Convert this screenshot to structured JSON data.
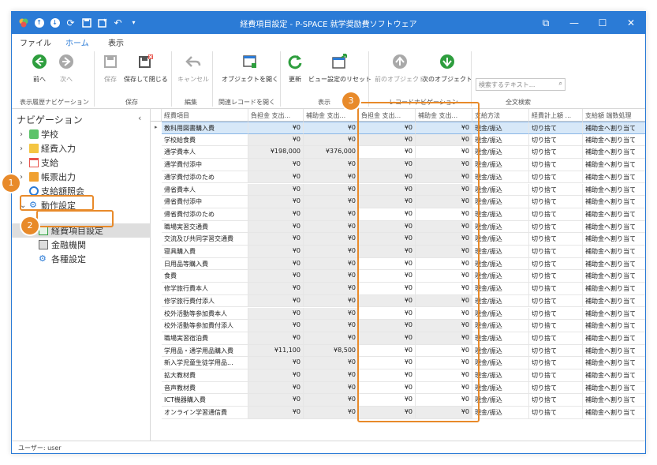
{
  "window": {
    "title": "経費項目設定 - P-SPACE 就学奨励費ソフトウェア",
    "controls": [
      "⧉",
      "—",
      "☐",
      "✕"
    ]
  },
  "menu": {
    "tabs": [
      "ファイル",
      "ホーム",
      "表示"
    ],
    "active": "ホーム"
  },
  "ribbon": {
    "buttons": {
      "forward_back": {
        "back": "前へ",
        "next": "次へ"
      },
      "save": "保存",
      "save_close": "保存して閉じる",
      "cancel": "キャンセル",
      "open_object": "オブジェクトを開く",
      "refresh": "更新",
      "view_reset": "ビュー設定のリセット",
      "prev_object": "前のオブジェクト",
      "next_object": "次のオブジェクト"
    },
    "groups": {
      "history": "表示履歴ナビゲーション",
      "save": "保存",
      "edit": "編集",
      "related": "関連レコードを開く",
      "view": "表示",
      "record_nav": "レコードナビゲーション",
      "fulltext": "全文検索"
    },
    "search_placeholder": "検索するテキスト..."
  },
  "nav": {
    "title": "ナビゲーション",
    "items": [
      "学校",
      "経費入力",
      "支給",
      "帳票出力",
      "支給額照会",
      "動作設定"
    ],
    "subitems": [
      "経費項目設定",
      "金融機関",
      "各種設定"
    ]
  },
  "grid": {
    "columns": [
      "経費項目",
      "負担金 支出...",
      "補助金 支出...",
      "負担金 支出...",
      "補助金 支出...",
      "支給方法",
      "経費計上額 ...",
      "支給額 端数処理"
    ],
    "rows": [
      [
        "教科用図書購入費",
        "¥0",
        "¥0",
        "¥0",
        "¥0",
        "現金/振込",
        "切り捨て",
        "補助金へ割り当て"
      ],
      [
        "学校給食費",
        "¥0",
        "¥0",
        "¥0",
        "¥0",
        "現金/振込",
        "切り捨て",
        "補助金へ割り当て"
      ],
      [
        "通学費本人",
        "¥198,000",
        "¥376,000",
        "¥0",
        "¥0",
        "現金/振込",
        "切り捨て",
        "補助金へ割り当て"
      ],
      [
        "通学費付添中",
        "¥0",
        "¥0",
        "¥0",
        "¥0",
        "現金/振込",
        "切り捨て",
        "補助金へ割り当て"
      ],
      [
        "通学費付添のため",
        "¥0",
        "¥0",
        "¥0",
        "¥0",
        "現金/振込",
        "切り捨て",
        "補助金へ割り当て"
      ],
      [
        "帰省費本人",
        "¥0",
        "¥0",
        "¥0",
        "¥0",
        "現金/振込",
        "切り捨て",
        "補助金へ割り当て"
      ],
      [
        "帰省費付添中",
        "¥0",
        "¥0",
        "¥0",
        "¥0",
        "現金/振込",
        "切り捨て",
        "補助金へ割り当て"
      ],
      [
        "帰省費付添のため",
        "¥0",
        "¥0",
        "¥0",
        "¥0",
        "現金/振込",
        "切り捨て",
        "補助金へ割り当て"
      ],
      [
        "職場実習交通費",
        "¥0",
        "¥0",
        "¥0",
        "¥0",
        "現金/振込",
        "切り捨て",
        "補助金へ割り当て"
      ],
      [
        "交流及び共同学習交通費",
        "¥0",
        "¥0",
        "¥0",
        "¥0",
        "現金/振込",
        "切り捨て",
        "補助金へ割り当て"
      ],
      [
        "寝具購入費",
        "¥0",
        "¥0",
        "¥0",
        "¥0",
        "現金/振込",
        "切り捨て",
        "補助金へ割り当て"
      ],
      [
        "日用品等購入費",
        "¥0",
        "¥0",
        "¥0",
        "¥0",
        "現金/振込",
        "切り捨て",
        "補助金へ割り当て"
      ],
      [
        "食費",
        "¥0",
        "¥0",
        "¥0",
        "¥0",
        "現金/振込",
        "切り捨て",
        "補助金へ割り当て"
      ],
      [
        "修学旅行費本人",
        "¥0",
        "¥0",
        "¥0",
        "¥0",
        "現金/振込",
        "切り捨て",
        "補助金へ割り当て"
      ],
      [
        "修学旅行費付添人",
        "¥0",
        "¥0",
        "¥0",
        "¥0",
        "現金/振込",
        "切り捨て",
        "補助金へ割り当て"
      ],
      [
        "校外活動等参加費本人",
        "¥0",
        "¥0",
        "¥0",
        "¥0",
        "現金/振込",
        "切り捨て",
        "補助金へ割り当て"
      ],
      [
        "校外活動等参加費付添人",
        "¥0",
        "¥0",
        "¥0",
        "¥0",
        "現金/振込",
        "切り捨て",
        "補助金へ割り当て"
      ],
      [
        "職場実習宿泊費",
        "¥0",
        "¥0",
        "¥0",
        "¥0",
        "現金/振込",
        "切り捨て",
        "補助金へ割り当て"
      ],
      [
        "学用品・通学用品購入費",
        "¥11,100",
        "¥8,500",
        "¥0",
        "¥0",
        "現金/振込",
        "切り捨て",
        "補助金へ割り当て"
      ],
      [
        "新入学児童生徒学用品...",
        "¥0",
        "¥0",
        "¥0",
        "¥0",
        "現金/振込",
        "切り捨て",
        "補助金へ割り当て"
      ],
      [
        "拡大教材費",
        "¥0",
        "¥0",
        "¥0",
        "¥0",
        "現金/振込",
        "切り捨て",
        "補助金へ割り当て"
      ],
      [
        "音声教材費",
        "¥0",
        "¥0",
        "¥0",
        "¥0",
        "現金/振込",
        "切り捨て",
        "補助金へ割り当て"
      ],
      [
        "ICT機器購入費",
        "¥0",
        "¥0",
        "¥0",
        "¥0",
        "現金/振込",
        "切り捨て",
        "補助金へ割り当て"
      ],
      [
        "オンライン学習通信費",
        "¥0",
        "¥0",
        "¥0",
        "¥0",
        "現金/振込",
        "切り捨て",
        "補助金へ割り当て"
      ]
    ],
    "selected_row": 0,
    "white_cells": [
      [
        0,
        3
      ],
      [
        0,
        4
      ],
      [
        2,
        3
      ],
      [
        2,
        4
      ],
      [
        7,
        3
      ],
      [
        7,
        4
      ],
      [
        11,
        3
      ],
      [
        11,
        4
      ],
      [
        12,
        3
      ],
      [
        12,
        4
      ],
      [
        13,
        3
      ],
      [
        15,
        3
      ],
      [
        15,
        4
      ],
      [
        18,
        3
      ],
      [
        18,
        4
      ],
      [
        19,
        3
      ],
      [
        20,
        3
      ],
      [
        21,
        3
      ],
      [
        21,
        4
      ],
      [
        22,
        3
      ],
      [
        22,
        4
      ]
    ]
  },
  "status": {
    "user": "ユーザー: user"
  },
  "callouts": [
    "1",
    "2",
    "3"
  ],
  "colors": {
    "accent": "#2b7bd6",
    "callout": "#e88a2a",
    "green": "#2e9e3e",
    "selected_row": "#d7e8f8"
  }
}
